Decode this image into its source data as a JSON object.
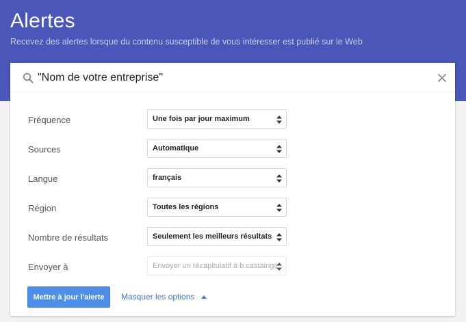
{
  "header": {
    "title": "Alertes",
    "subtitle": "Recevez des alertes lorsque du contenu susceptible de vous intéresser est publié sur le Web"
  },
  "search": {
    "value": "\"Nom de votre entreprise\"",
    "icon": "search-icon",
    "clear_icon": "close-icon"
  },
  "options": [
    {
      "label": "Fréquence",
      "value": "Une fois par jour maximum"
    },
    {
      "label": "Sources",
      "value": "Automatique"
    },
    {
      "label": "Langue",
      "value": "français"
    },
    {
      "label": "Région",
      "value": "Toutes les régions"
    },
    {
      "label": "Nombre de résultats",
      "value": "Seulement les meilleurs résultats"
    },
    {
      "label": "Envoyer à",
      "value": "Envoyer un récapitulatif à b.castaing@",
      "disabled": true
    }
  ],
  "actions": {
    "update_label": "Mettre à jour l'alerte",
    "toggle_options_label": "Masquer les options"
  },
  "colors": {
    "header_bg": "#4a56b8",
    "primary_button": "#4d8fe8",
    "link": "#3f78d8"
  }
}
